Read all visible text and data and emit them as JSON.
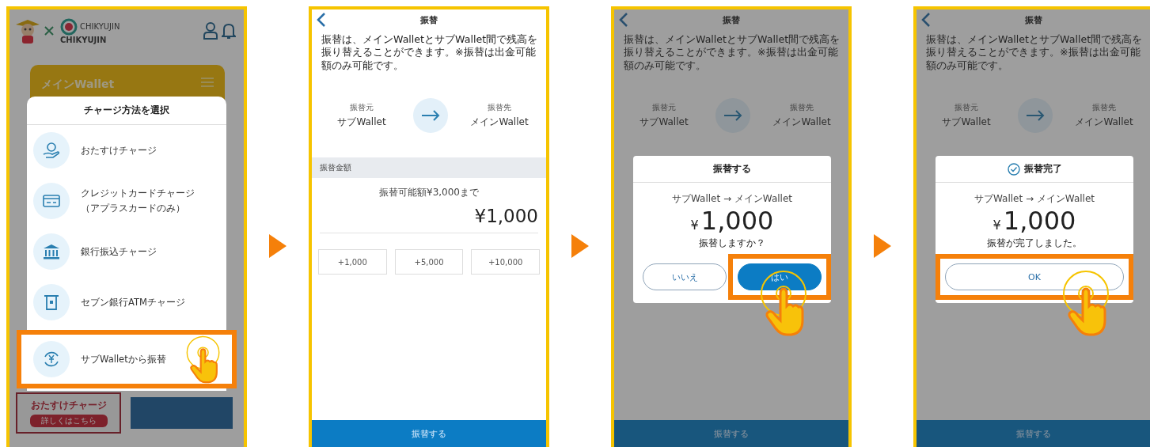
{
  "steps": [
    {
      "kind": "menu",
      "brand": "CHIKYUJIN",
      "brand_small": "CHIKYUJIN",
      "wallet_title": "メインWallet",
      "sheet_title": "チャージ方法を選択",
      "items": [
        {
          "kind": "hand",
          "label": "おたすけチャージ",
          "highlighted": false
        },
        {
          "kind": "card",
          "label": "クレジットカードチャージ",
          "note": "（アプラスカードのみ）",
          "highlighted": false
        },
        {
          "kind": "bank",
          "label": "銀行振込チャージ",
          "highlighted": false
        },
        {
          "kind": "atm",
          "label": "セブン銀行ATMチャージ",
          "highlighted": false
        },
        {
          "kind": "exchange",
          "label": "サブWalletから振替",
          "highlighted": true
        }
      ],
      "banner": {
        "title": "おたすけチャージ",
        "link": "詳しくはこちら"
      }
    },
    {
      "kind": "transfer",
      "title": "振替",
      "description": "振替は、メインWalletとサブWallet間で残高を振り替えることができます。※振替は出金可能額のみ可能です。",
      "from_label": "振替元",
      "from": "サブWallet",
      "to_label": "振替先",
      "to": "メインWallet",
      "section": "振替金額",
      "hint": "振替可能額¥3,000まで",
      "amount": "¥1,000",
      "quick_amounts": [
        "+1,000",
        "+5,000",
        "+10,000"
      ],
      "submit": "振替する"
    },
    {
      "kind": "transfer",
      "title": "振替",
      "description": "振替は、メインWalletとサブWallet間で残高を振り替えることができます。※振替は出金可能額のみ可能です。",
      "from_label": "振替元",
      "from": "サブWallet",
      "to_label": "振替先",
      "to": "メインWallet",
      "submit": "振替する",
      "dialog": {
        "kind": "confirm",
        "title": "振替する",
        "route": "サブWallet → メインWallet",
        "currency": "¥",
        "amount": "1,000",
        "message": "振替しますか？",
        "buttons": [
          {
            "label": "いいえ",
            "primary": false,
            "highlighted": false
          },
          {
            "label": "はい",
            "primary": true,
            "highlighted": true
          }
        ]
      }
    },
    {
      "kind": "transfer",
      "title": "振替",
      "description": "振替は、メインWalletとサブWallet間で残高を振り替えることができます。※振替は出金可能額のみ可能です。",
      "from_label": "振替元",
      "from": "サブWallet",
      "to_label": "振替先",
      "to": "メインWallet",
      "submit": "振替する",
      "dialog": {
        "kind": "done",
        "title": "振替完了",
        "route": "サブWallet → メインWallet",
        "currency": "¥",
        "amount": "1,000",
        "message": "振替が完了しました。",
        "buttons": [
          {
            "label": "OK",
            "primary": false,
            "highlighted": true
          }
        ]
      }
    }
  ]
}
